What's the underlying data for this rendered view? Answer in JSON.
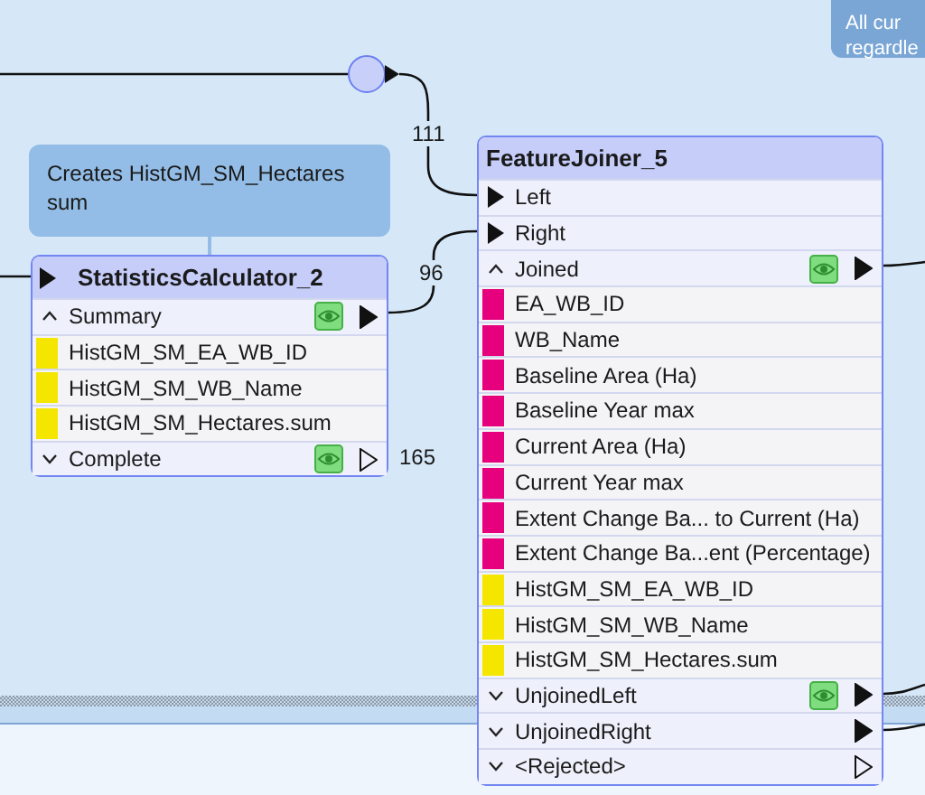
{
  "annotations": [
    {
      "lines": [
        "Creates HistGM_SM_Hectares",
        "sum"
      ]
    },
    {
      "lines": [
        "All cur",
        "regardle"
      ]
    }
  ],
  "connections": [
    {
      "count": "111"
    },
    {
      "count": "96"
    }
  ],
  "transformers": [
    {
      "title": "StatisticsCalculator_2",
      "input_port": true,
      "rows": [
        {
          "kind": "output",
          "label": "Summary",
          "expanded": true,
          "inspect": true,
          "connected": true
        },
        {
          "kind": "attribute",
          "label": "HistGM_SM_EA_WB_ID",
          "color": "#f5e600"
        },
        {
          "kind": "attribute",
          "label": "HistGM_SM_WB_Name",
          "color": "#f5e600"
        },
        {
          "kind": "attribute",
          "label": "HistGM_SM_Hectares.sum",
          "color": "#f5e600"
        },
        {
          "kind": "output",
          "label": "Complete",
          "expanded": false,
          "inspect": true,
          "connected": false,
          "count": "165"
        }
      ]
    },
    {
      "title": "FeatureJoiner_5",
      "input_port": false,
      "rows": [
        {
          "kind": "input",
          "label": "Left"
        },
        {
          "kind": "input",
          "label": "Right"
        },
        {
          "kind": "output",
          "label": "Joined",
          "expanded": true,
          "inspect": true,
          "connected": true
        },
        {
          "kind": "attribute",
          "label": "EA_WB_ID",
          "color": "#e6007e"
        },
        {
          "kind": "attribute",
          "label": "WB_Name",
          "color": "#e6007e"
        },
        {
          "kind": "attribute",
          "label": "Baseline Area (Ha)",
          "color": "#e6007e"
        },
        {
          "kind": "attribute",
          "label": "Baseline Year max",
          "color": "#e6007e"
        },
        {
          "kind": "attribute",
          "label": "Current Area (Ha)",
          "color": "#e6007e"
        },
        {
          "kind": "attribute",
          "label": "Current Year max",
          "color": "#e6007e"
        },
        {
          "kind": "attribute",
          "label": "Extent Change Ba... to Current (Ha)",
          "color": "#e6007e"
        },
        {
          "kind": "attribute",
          "label": "Extent Change Ba...ent (Percentage)",
          "color": "#e6007e"
        },
        {
          "kind": "attribute",
          "label": "HistGM_SM_EA_WB_ID",
          "color": "#f5e600"
        },
        {
          "kind": "attribute",
          "label": "HistGM_SM_WB_Name",
          "color": "#f5e600"
        },
        {
          "kind": "attribute",
          "label": "HistGM_SM_Hectares.sum",
          "color": "#f5e600"
        },
        {
          "kind": "output",
          "label": "UnjoinedLeft",
          "expanded": false,
          "inspect": true,
          "connected": true
        },
        {
          "kind": "output",
          "label": "UnjoinedRight",
          "expanded": false,
          "inspect": false,
          "connected": true
        },
        {
          "kind": "output",
          "label": "<Rejected>",
          "expanded": false,
          "inspect": false,
          "connected": false
        }
      ]
    }
  ]
}
